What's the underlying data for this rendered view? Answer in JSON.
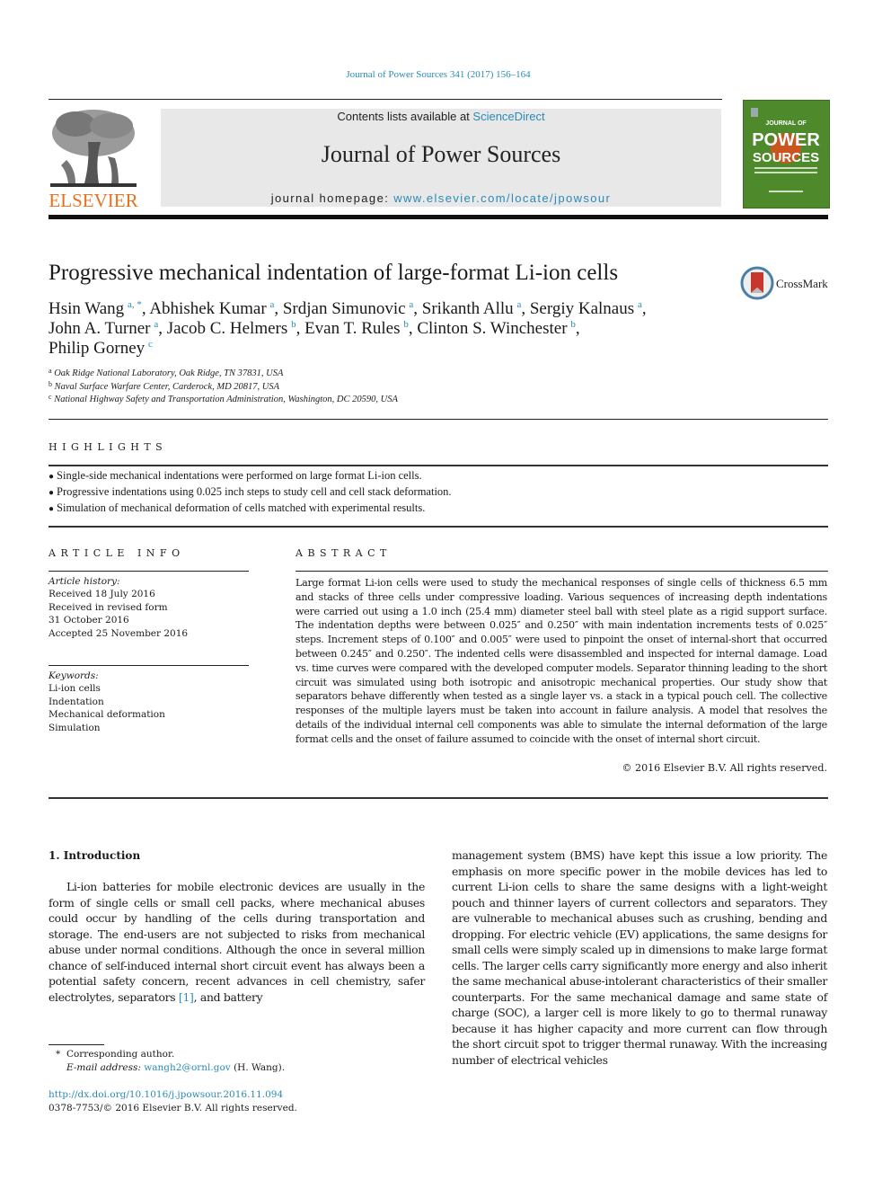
{
  "journal_ref": "Journal of Power Sources 341 (2017) 156–164",
  "masthead": {
    "publisher_logo_text": "ELSEVIER",
    "contents_prefix": "Contents lists available at ",
    "contents_link": "ScienceDirect",
    "journal_title": "Journal of Power Sources",
    "homepage_prefix": "journal homepage: ",
    "homepage_link": "www.elsevier.com/locate/jpowsour",
    "cover_lines": [
      "JOURNAL OF",
      "POWER",
      "SOURCES"
    ]
  },
  "article": {
    "title": "Progressive mechanical indentation of large-format Li-ion cells",
    "crossmark_label": "CrossMark",
    "authors": [
      {
        "name": "Hsin Wang",
        "sup": "a, *",
        "sep": ", "
      },
      {
        "name": "Abhishek Kumar",
        "sup": "a",
        "sep": ", "
      },
      {
        "name": "Srdjan Simunovic",
        "sup": "a",
        "sep": ", "
      },
      {
        "name": "Srikanth Allu",
        "sup": "a",
        "sep": ", "
      },
      {
        "name": "Sergiy Kalnaus",
        "sup": "a",
        "sep": ","
      },
      {
        "name": "John A. Turner",
        "sup": "a",
        "sep": ", "
      },
      {
        "name": "Jacob C. Helmers",
        "sup": "b",
        "sep": ", "
      },
      {
        "name": "Evan T. Rules",
        "sup": "b",
        "sep": ", "
      },
      {
        "name": "Clinton S. Winchester",
        "sup": "b",
        "sep": ","
      },
      {
        "name": "Philip Gorney",
        "sup": "c",
        "sep": ""
      }
    ],
    "affiliations": [
      {
        "key": "a",
        "text": "Oak Ridge National Laboratory, Oak Ridge, TN 37831, USA"
      },
      {
        "key": "b",
        "text": "Naval Surface Warfare Center, Carderock, MD 20817, USA"
      },
      {
        "key": "c",
        "text": "National Highway Safety and Transportation Administration, Washington, DC 20590, USA"
      }
    ]
  },
  "highlights": {
    "heading": "HIGHLIGHTS",
    "items": [
      "Single-side mechanical indentations were performed on large format Li-ion cells.",
      "Progressive indentations using 0.025 inch steps to study cell and cell stack deformation.",
      "Simulation of mechanical deformation of cells matched with experimental results."
    ]
  },
  "article_info": {
    "heading": "ARTICLE INFO",
    "history_label": "Article history:",
    "history": [
      "Received 18 July 2016",
      "Received in revised form",
      "31 October 2016",
      "Accepted 25 November 2016"
    ],
    "keywords_label": "Keywords:",
    "keywords": [
      "Li-ion cells",
      "Indentation",
      "Mechanical deformation",
      "Simulation"
    ]
  },
  "abstract": {
    "heading": "ABSTRACT",
    "text": "Large format Li-ion cells were used to study the mechanical responses of single cells of thickness 6.5 mm and stacks of three cells under compressive loading. Various sequences of increasing depth indentations were carried out using a 1.0 inch (25.4 mm) diameter steel ball with steel plate as a rigid support surface. The indentation depths were between 0.025″ and 0.250″ with main indentation increments tests of 0.025″ steps. Increment steps of 0.100″ and 0.005″ were used to pinpoint the onset of internal-short that occurred between 0.245″ and 0.250″. The indented cells were disassembled and inspected for internal damage. Load vs. time curves were compared with the developed computer models. Separator thinning leading to the short circuit was simulated using both isotropic and anisotropic mechanical properties. Our study show that separators behave differently when tested as a single layer vs. a stack in a typical pouch cell. The collective responses of the multiple layers must be taken into account in failure analysis. A model that resolves the details of the individual internal cell components was able to simulate the internal deformation of the large format cells and the onset of failure assumed to coincide with the onset of internal short circuit.",
    "copyright": "© 2016 Elsevier B.V. All rights reserved."
  },
  "introduction": {
    "heading": "1.  Introduction",
    "left_before_ref": "Li-ion batteries for mobile electronic devices are usually in the form of single cells or small cell packs, where mechanical abuses could occur by handling of the cells during transportation and storage. The end-users are not subjected to risks from mechanical abuse under normal conditions. Although the once in several million chance of self-induced internal short circuit event has al­ways been a potential safety concern, recent advances in cell chemistry, safer electrolytes, separators ",
    "ref": "[1]",
    "left_after_ref": ", and battery",
    "right": "management system (BMS) have kept this issue a low priority. The emphasis on more specific power in the mobile devices has led to current Li-ion cells to share the same designs with a light-weight pouch and thinner layers of current collectors and separators. They are vulnerable to mechanical abuses such as crushing, bending and dropping. For electric vehicle (EV) applications, the same designs for small cells were simply scaled up in dimensions to make large format cells. The larger cells carry significantly more energy and also inherit the same mechanical abuse-intolerant characteristics of their smaller counterparts. For the same me­chanical damage and same state of charge (SOC), a larger cell is more likely to go to thermal runaway because it has higher capacity and more current can flow through the short circuit spot to trigger thermal runaway. With the increasing number of electrical vehicles"
  },
  "footnotes": {
    "corresponding_mark": "*",
    "corresponding_text": "Corresponding author.",
    "email_label": "E-mail address: ",
    "email": "wangh2@ornl.gov",
    "email_suffix": " (H. Wang).",
    "doi": "http://dx.doi.org/10.1016/j.jpowsour.2016.11.094",
    "issn_copyright": "0378-7753/© 2016 Elsevier B.V. All rights reserved."
  },
  "colors": {
    "link": "#2a8ab8",
    "elsevier_orange": "#e8711e",
    "cover_green": "#4e8a2c",
    "masthead_gray": "#e8e8e8"
  }
}
